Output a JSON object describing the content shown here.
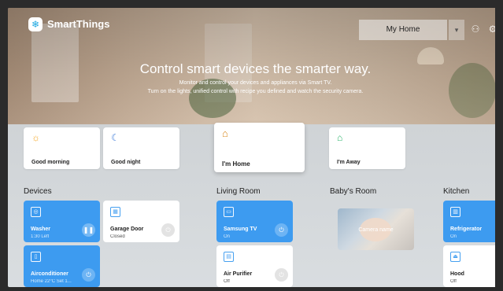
{
  "app": {
    "brand": "SmartThings",
    "home_selector": "My Home",
    "dropdown_glyph": "▾",
    "icons": {
      "logo": "snowflake-logo-icon",
      "user": "person-icon",
      "settings": "gear-icon"
    }
  },
  "hero": {
    "title": "Control smart devices the smarter way.",
    "subtitle_1": "Monitor and control your devices and appliances via Smart TV.",
    "subtitle_2": "Turn on the lights, unified control with recipe you defined and watch the security camera."
  },
  "scenes": [
    {
      "label": "Good morning",
      "icon": "sun-icon"
    },
    {
      "label": "Good night",
      "icon": "moon-icon"
    },
    {
      "label": "I'm Home",
      "icon": "home-arrive-icon"
    },
    {
      "label": "I'm Away",
      "icon": "home-leave-icon"
    }
  ],
  "sections": {
    "devices": "Devices",
    "living_room": "Living Room",
    "babys_room": "Baby's Room",
    "kitchen": "Kitchen"
  },
  "devices": {
    "washer": {
      "name": "Washer",
      "status": "1:30 Left",
      "icon": "washer-icon",
      "action": "pause-icon",
      "action_glyph": "❚❚"
    },
    "garage": {
      "name": "Garage Door",
      "status": "Closed",
      "icon": "garage-icon"
    },
    "aircon": {
      "name": "Airconditioner",
      "status": "Home 22°C Set 1...",
      "icon": "aircon-icon"
    },
    "tv": {
      "name": "Samsung TV",
      "status": "On",
      "icon": "tv-icon"
    },
    "purifier": {
      "name": "Air Purifier",
      "status": "Off",
      "icon": "purifier-icon"
    },
    "camera": {
      "caption": "Camera name",
      "icon": "camera-icon"
    },
    "fridge": {
      "name": "Refrigerator",
      "status": "On",
      "icon": "fridge-icon"
    },
    "hood": {
      "name": "Hood",
      "status": "Off",
      "icon": "hood-icon"
    }
  },
  "power_glyph": "⏻",
  "colors": {
    "accent": "#3d9bf0",
    "card": "#ffffff",
    "panel": "#d9dde0"
  }
}
